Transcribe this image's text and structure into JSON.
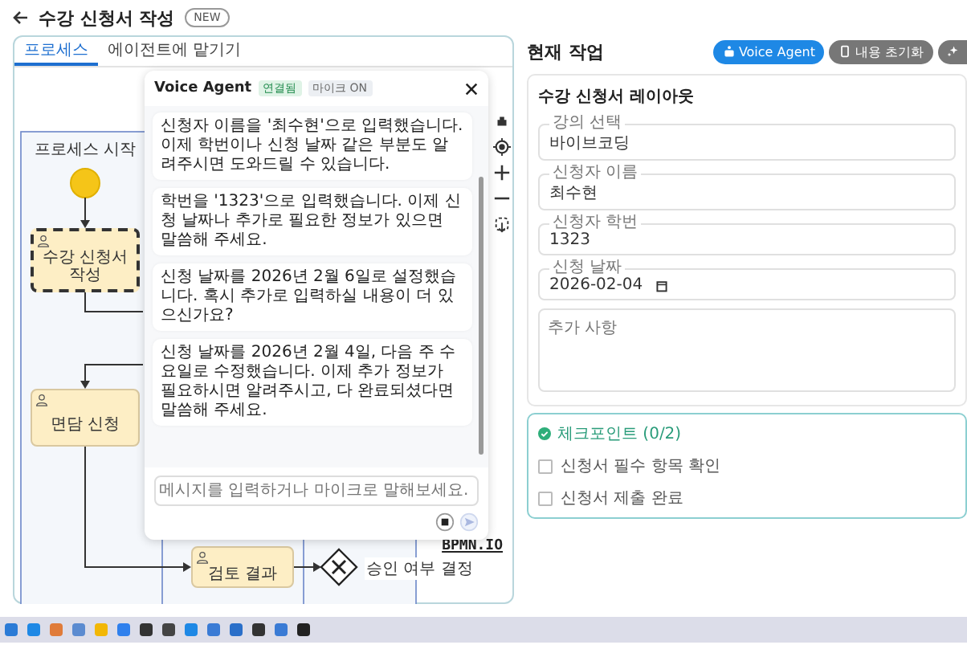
{
  "header": {
    "title": "수강 신청서 작성",
    "badge": "NEW"
  },
  "process_panel": {
    "tabs": [
      {
        "label": "프로세스",
        "selected": true
      },
      {
        "label": "에이전트에 맡기기",
        "selected": false
      }
    ],
    "diagram": {
      "start_label": "프로세스 시작",
      "tasks": [
        {
          "label": "수강 신청서 작성",
          "selected": true
        },
        {
          "label": "면담 신청",
          "selected": false
        },
        {
          "label": "검토 결과",
          "selected": false
        }
      ],
      "gateway_label": "승인 여부 결정",
      "logo": "BPMN.IO"
    }
  },
  "voice_agent": {
    "title": "Voice Agent",
    "badges": [
      {
        "label": "연결됨",
        "kind": "connected"
      },
      {
        "label": "마이크 ON",
        "kind": "mic"
      }
    ],
    "messages": [
      "신청자 이름을 '최수현'으로 입력했습니다. 이제 학번이나 신청 날짜 같은 부분도 알려주시면 도와드릴 수 있습니다.",
      "학번을 '1323'으로 입력했습니다. 이제 신청 날짜나 추가로 필요한 정보가 있으면 말씀해 주세요.",
      "신청 날짜를 2026년 2월 6일로 설정했습니다. 혹시 추가로 입력하실 내용이 더 있으신가요?",
      "신청 날짜를 2026년 2월 4일, 다음 주 수요일로 수정했습니다. 이제 추가 정보가 필요하시면 알려주시고, 다 완료되셨다면 말씀해 주세요."
    ],
    "input": {
      "placeholder": "메시지를 입력하거나 마이크로 말해보세요."
    },
    "send_disabled": true
  },
  "current_task": {
    "title": "현재 작업",
    "buttons": [
      {
        "kind": "primary",
        "label": "Voice Agent"
      },
      {
        "kind": "secondary",
        "label": "내용 초기화"
      },
      {
        "kind": "icon"
      }
    ],
    "form": {
      "title": "수강 신청서 레이아웃",
      "fields": [
        {
          "kind": "text",
          "label": "강의 선택",
          "value": "바이브코딩"
        },
        {
          "kind": "text",
          "label": "신청자 이름",
          "value": "최수현"
        },
        {
          "kind": "text",
          "label": "신청자 학번",
          "value": "1323"
        },
        {
          "kind": "date",
          "label": "신청 날짜",
          "value": "2026-02-04"
        },
        {
          "kind": "textarea",
          "placeholder": "추가 사항"
        }
      ]
    },
    "checklist": {
      "title": "체크포인트 (0/2)",
      "items": [
        {
          "label": "신청서 필수 항목 확인",
          "checked": false
        },
        {
          "label": "신청서 제출 완료",
          "checked": false
        }
      ]
    }
  }
}
